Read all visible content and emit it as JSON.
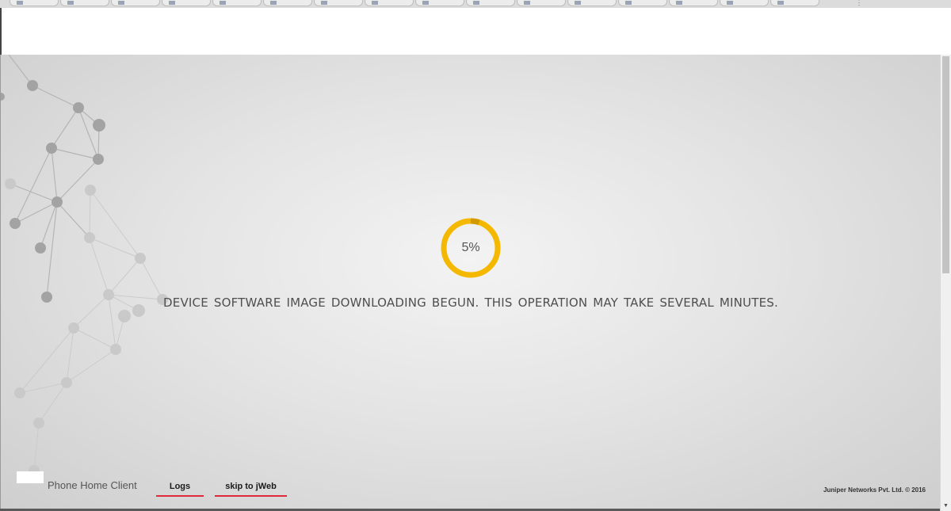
{
  "progress": {
    "text": "5%",
    "fraction": 0.05,
    "ring_color": "#f5b800",
    "ring_dark_color": "#d39a00"
  },
  "status": {
    "message": "DEVICE SOFTWARE IMAGE DOWNLOADING BEGUN. THIS OPERATION MAY TAKE SEVERAL MINUTES."
  },
  "footer": {
    "app_title": "Phone Home Client",
    "links": {
      "logs": "Logs",
      "skip_to_jweb": "skip to jWeb"
    },
    "copyright": "Juniper Networks Pvt. Ltd. © 2016",
    "link_underline_color": "#e0293a"
  },
  "icons": {
    "menu": "three-dot-menu-icon",
    "scroll_down": "chevron-down-icon"
  }
}
